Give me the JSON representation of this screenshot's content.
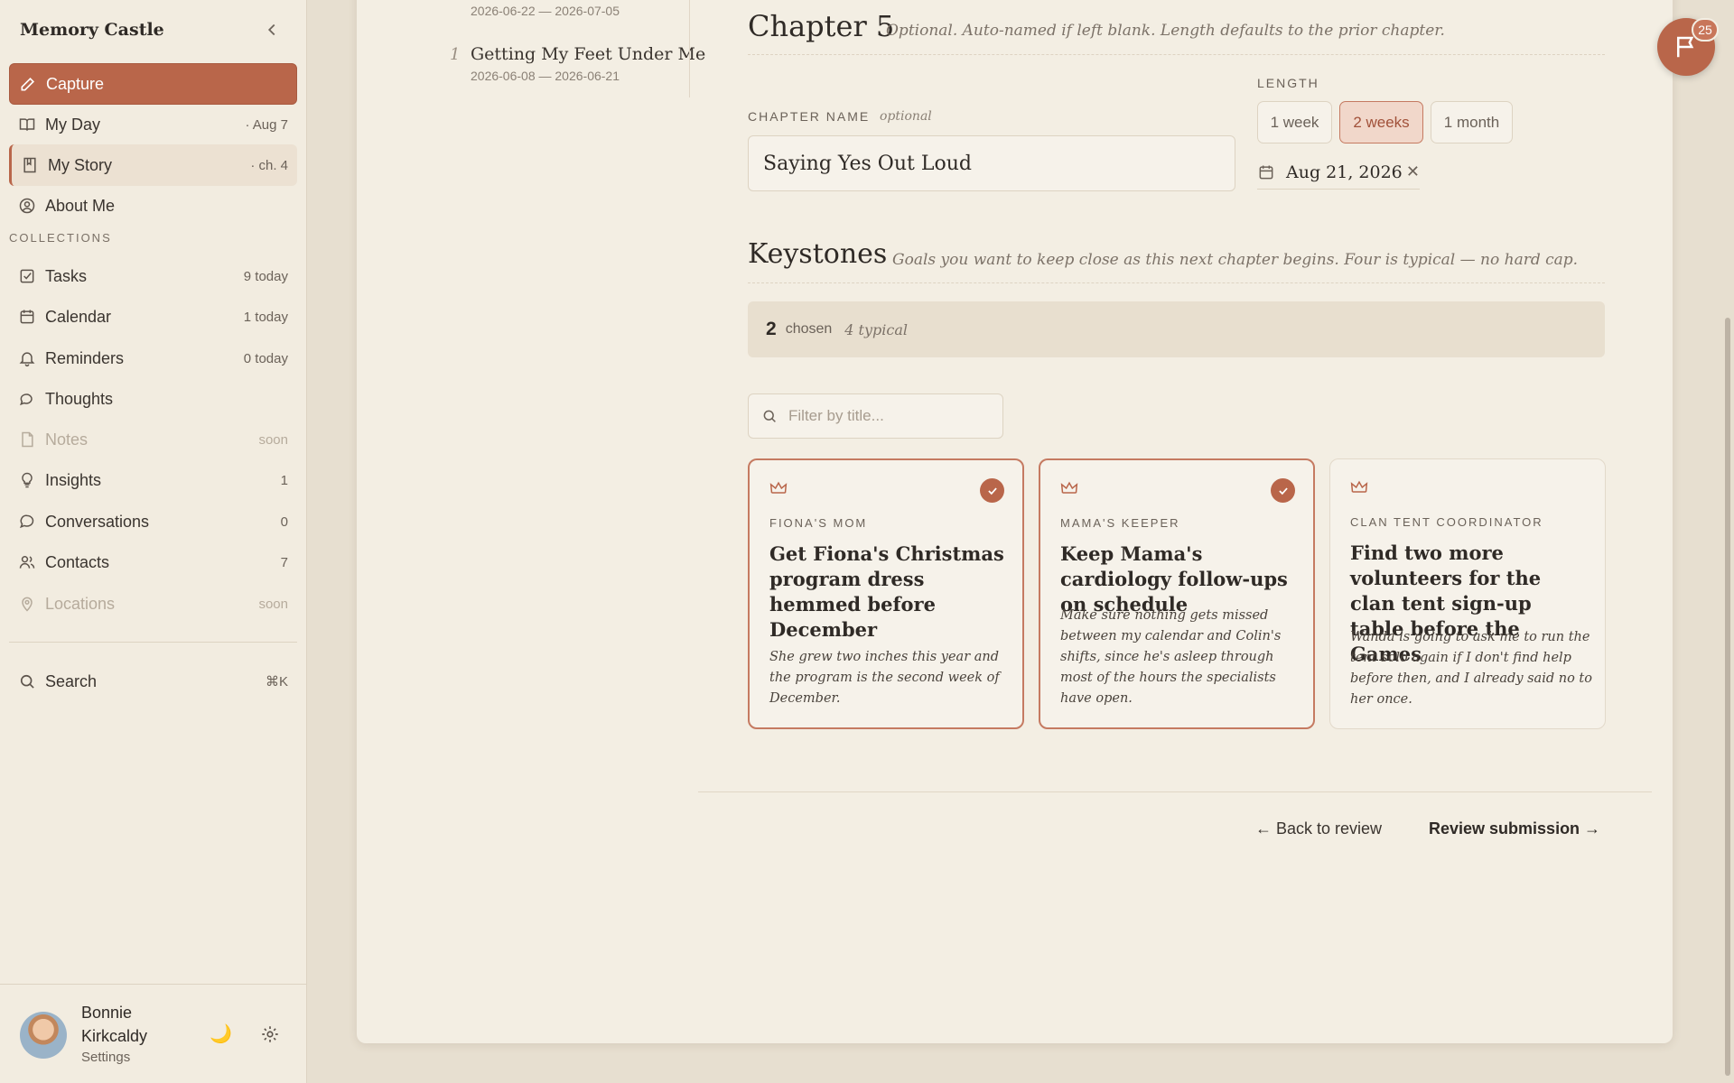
{
  "app": {
    "name": "Memory Castle"
  },
  "sidebar": {
    "items": [
      {
        "label": "Capture",
        "meta": "",
        "icon": "pencil-icon"
      },
      {
        "label": "My Day",
        "meta": "· Aug 7",
        "icon": "book-open-icon"
      },
      {
        "label": "My Story",
        "meta": "· ch. 4",
        "icon": "bookmark-book-icon"
      },
      {
        "label": "About Me",
        "meta": "",
        "icon": "user-circle-icon"
      }
    ],
    "collections_label": "COLLECTIONS",
    "collections": [
      {
        "label": "Tasks",
        "meta": "9 today",
        "icon": "checkbox-icon"
      },
      {
        "label": "Calendar",
        "meta": "1 today",
        "icon": "calendar-icon"
      },
      {
        "label": "Reminders",
        "meta": "0 today",
        "icon": "bell-icon"
      },
      {
        "label": "Thoughts",
        "meta": "",
        "icon": "speech-bubble-icon"
      },
      {
        "label": "Notes",
        "meta": "soon",
        "icon": "note-icon"
      },
      {
        "label": "Insights",
        "meta": "1",
        "icon": "lightbulb-icon"
      },
      {
        "label": "Conversations",
        "meta": "0",
        "icon": "chat-icon"
      },
      {
        "label": "Contacts",
        "meta": "7",
        "icon": "people-icon"
      },
      {
        "label": "Locations",
        "meta": "soon",
        "icon": "pin-icon"
      }
    ],
    "search": {
      "label": "Search",
      "shortcut": "⌘K"
    },
    "profile": {
      "name": "Bonnie Kirkcaldy",
      "sub": "Settings"
    }
  },
  "timeline": {
    "prev_dates": "2026-06-22 — 2026-07-05",
    "item_num": "1",
    "item_title": "Getting My Feet Under Me",
    "item_dates": "2026-06-08 — 2026-06-21"
  },
  "chapter": {
    "heading": "Chapter 5",
    "hint": "Optional. Auto-named if left blank. Length defaults to the prior chapter.",
    "name_label": "CHAPTER NAME",
    "name_optional": "optional",
    "name_value": "Saying Yes Out Loud",
    "length_label": "LENGTH",
    "length_options": [
      "1 week",
      "2 weeks",
      "1 month"
    ],
    "length_selected": "2 weeks",
    "end_date": "Aug 21, 2026"
  },
  "keystones": {
    "heading": "Keystones",
    "hint": "Goals you want to keep close as this next chapter begins. Four is typical — no hard cap.",
    "count": "2",
    "chosen_label": "chosen",
    "typical_label": "4 typical",
    "filter_placeholder": "Filter by title...",
    "cards": [
      {
        "role": "FIONA'S MOM",
        "title": "Get Fiona's Christmas program dress hemmed before December",
        "desc": "She grew two inches this year and the program is the second week of December.",
        "selected": true
      },
      {
        "role": "MAMA'S KEEPER",
        "title": "Keep Mama's cardiology follow-ups on schedule",
        "desc": "Make sure nothing gets missed between my calendar and Colin's shifts, since he's asleep through most of the hours the specialists have open.",
        "selected": true
      },
      {
        "role": "CLAN TENT COORDINATOR",
        "title": "Find two more volunteers for the clan tent sign-up table before the Games",
        "desc": "Wanda is going to ask me to run the tent solo again if I don't find help before then, and I already said no to her once.",
        "selected": false
      }
    ]
  },
  "footer": {
    "back": "← Back to review",
    "next": "Review submission →"
  },
  "fab": {
    "badge": "25",
    "icon": "flag-icon"
  },
  "colors": {
    "accent": "#b9664a",
    "background": "#f3eee3",
    "sidebar": "#f2ece0"
  }
}
